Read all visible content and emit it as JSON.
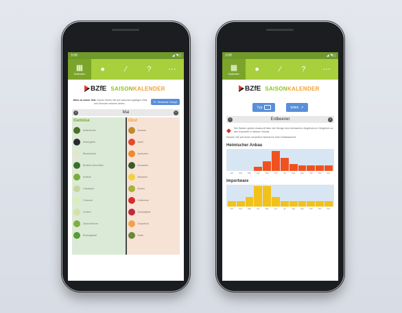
{
  "status": {
    "time": "3:08",
    "signal": "◢ ◥ ▯"
  },
  "tabs": [
    {
      "label": "Kalender",
      "icon": "calendar-icon"
    },
    {
      "label": "",
      "icon": "cherry-icon"
    },
    {
      "label": "",
      "icon": "carrot-icon"
    },
    {
      "label": "",
      "icon": "help-icon"
    },
    {
      "label": "",
      "icon": "more-icon"
    }
  ],
  "brand": {
    "logo": "BZfE",
    "title_part1": "SAISON",
    "title_part2": "KALENDER"
  },
  "left": {
    "intro_bold": "Alles zu seiner Zeit.",
    "intro_text": "Darum führen Sie auf saisonal ungiftiges Obst und Gemüse nehmen Ambe...",
    "button": "Verstand: Haupt",
    "month": "Mai",
    "veg_title": "Gemüse",
    "fruit_title": "Obst",
    "veg": [
      {
        "name": "Artischocke",
        "color": "#4b6f2a"
      },
      {
        "name": "Auberginen",
        "color": "#2a2a30"
      },
      {
        "name": "Blumenkohl",
        "color": "#e6e4cc"
      },
      {
        "name": "Brokkoli (Zucchini)",
        "color": "#3e6f2a"
      },
      {
        "name": "Endivie",
        "color": "#7bab3c"
      },
      {
        "name": "Chinakohl",
        "color": "#c6d6a2"
      },
      {
        "name": "Chicoree",
        "color": "#dcecb8"
      },
      {
        "name": "Gurken",
        "color": "#d4e0a6"
      },
      {
        "name": "Dicke Bohnen",
        "color": "#7fae42"
      },
      {
        "name": "Eisbergsalat",
        "color": "#5a9a3a"
      }
    ],
    "fruit": [
      {
        "name": "Ananas",
        "color": "#c08a2c"
      },
      {
        "name": "Apfel",
        "color": "#e64a2a"
      },
      {
        "name": "Aprikosen",
        "color": "#f08a2a"
      },
      {
        "name": "Avocados",
        "color": "#3a5a2a"
      },
      {
        "name": "Bananen",
        "color": "#f2d23a"
      },
      {
        "name": "Birnen",
        "color": "#a8b23a"
      },
      {
        "name": "Erdbeeren",
        "color": "#d82c2c"
      },
      {
        "name": "Granatäpfel",
        "color": "#c02a3a"
      },
      {
        "name": "Grapefruit",
        "color": "#f4a04a"
      },
      {
        "name": "Kiwis",
        "color": "#6a8a3a"
      }
    ]
  },
  "right": {
    "btn_type": "Typ",
    "btn_share": "teilen",
    "title": "Erdbeeren",
    "desc": "Die Säulen geben Auskunft über die Menge des heimischen Angebots im Vergleich zu den Importen in diesem Monat.",
    "hint": "Klicken Sie auf einen einzelnen Monat für eine Detailansicht.",
    "chart1_title": "Heimischer Anbau",
    "chart2_title": "Importware"
  },
  "chart_data": [
    {
      "type": "bar",
      "title": "Heimischer Anbau",
      "categories": [
        "Jan",
        "Feb",
        "Mär",
        "Apr",
        "Mai",
        "Jun",
        "Jul",
        "Aug",
        "Sep",
        "Okt",
        "Nov",
        "Dez"
      ],
      "values": [
        0,
        0,
        0,
        20,
        45,
        90,
        60,
        30,
        25,
        25,
        25,
        25
      ],
      "ylim": [
        0,
        100
      ],
      "color": "#f0521f"
    },
    {
      "type": "bar",
      "title": "Importware",
      "categories": [
        "Jan",
        "Feb",
        "Mär",
        "Apr",
        "Mai",
        "Jun",
        "Jul",
        "Aug",
        "Sep",
        "Okt",
        "Nov",
        "Dez"
      ],
      "values": [
        25,
        25,
        45,
        95,
        95,
        45,
        25,
        25,
        25,
        25,
        25,
        25
      ],
      "ylim": [
        0,
        100
      ],
      "color": "#f2c21a"
    }
  ]
}
